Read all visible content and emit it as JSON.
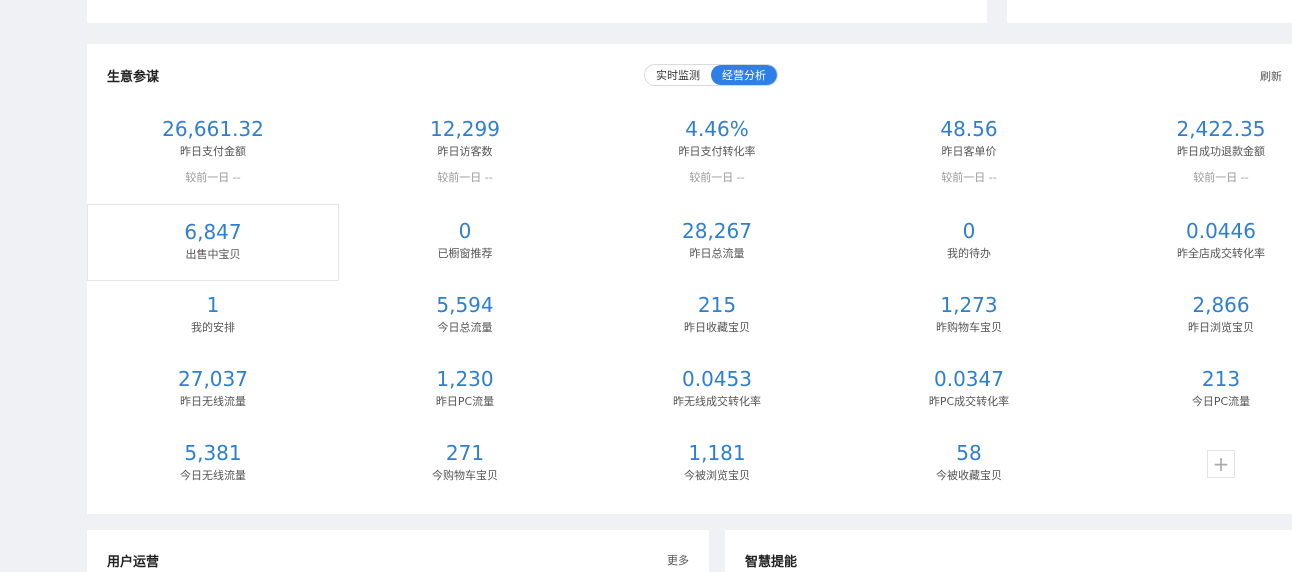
{
  "panel": {
    "title": "生意参谋",
    "tabs": [
      "实时监测",
      "经营分析"
    ],
    "active_tab": "经营分析",
    "refresh": "刷新"
  },
  "metrics_row1": [
    {
      "value": "26,661.32",
      "label": "昨日支付金额",
      "compare": "较前一日 --"
    },
    {
      "value": "12,299",
      "label": "昨日访客数",
      "compare": "较前一日 --"
    },
    {
      "value": "4.46%",
      "label": "昨日支付转化率",
      "compare": "较前一日 --"
    },
    {
      "value": "48.56",
      "label": "昨日客单价",
      "compare": "较前一日 --"
    },
    {
      "value": "2,422.35",
      "label": "昨日成功退款金额",
      "compare": "较前一日 --"
    }
  ],
  "metrics_row2": [
    {
      "value": "6,847",
      "label": "出售中宝贝"
    },
    {
      "value": "0",
      "label": "已橱窗推荐"
    },
    {
      "value": "28,267",
      "label": "昨日总流量"
    },
    {
      "value": "0",
      "label": "我的待办"
    },
    {
      "value": "0.0446",
      "label": "昨全店成交转化率"
    }
  ],
  "metrics_row3": [
    {
      "value": "1",
      "label": "我的安排"
    },
    {
      "value": "5,594",
      "label": "今日总流量"
    },
    {
      "value": "215",
      "label": "昨日收藏宝贝"
    },
    {
      "value": "1,273",
      "label": "昨购物车宝贝"
    },
    {
      "value": "2,866",
      "label": "昨日浏览宝贝"
    }
  ],
  "metrics_row4": [
    {
      "value": "27,037",
      "label": "昨日无线流量"
    },
    {
      "value": "1,230",
      "label": "昨日PC流量"
    },
    {
      "value": "0.0453",
      "label": "昨无线成交转化率"
    },
    {
      "value": "0.0347",
      "label": "昨PC成交转化率"
    },
    {
      "value": "213",
      "label": "今日PC流量"
    }
  ],
  "metrics_row5": [
    {
      "value": "5,381",
      "label": "今日无线流量"
    },
    {
      "value": "271",
      "label": "今购物车宝贝"
    },
    {
      "value": "1,181",
      "label": "今被浏览宝贝"
    },
    {
      "value": "58",
      "label": "今被收藏宝贝"
    }
  ],
  "add_button": "+",
  "user_ops": {
    "title": "用户运营",
    "more": "更多"
  },
  "smart": {
    "title": "智慧提能"
  },
  "colors": {
    "accent": "#2f7fe8",
    "value": "#2d7fd4"
  }
}
